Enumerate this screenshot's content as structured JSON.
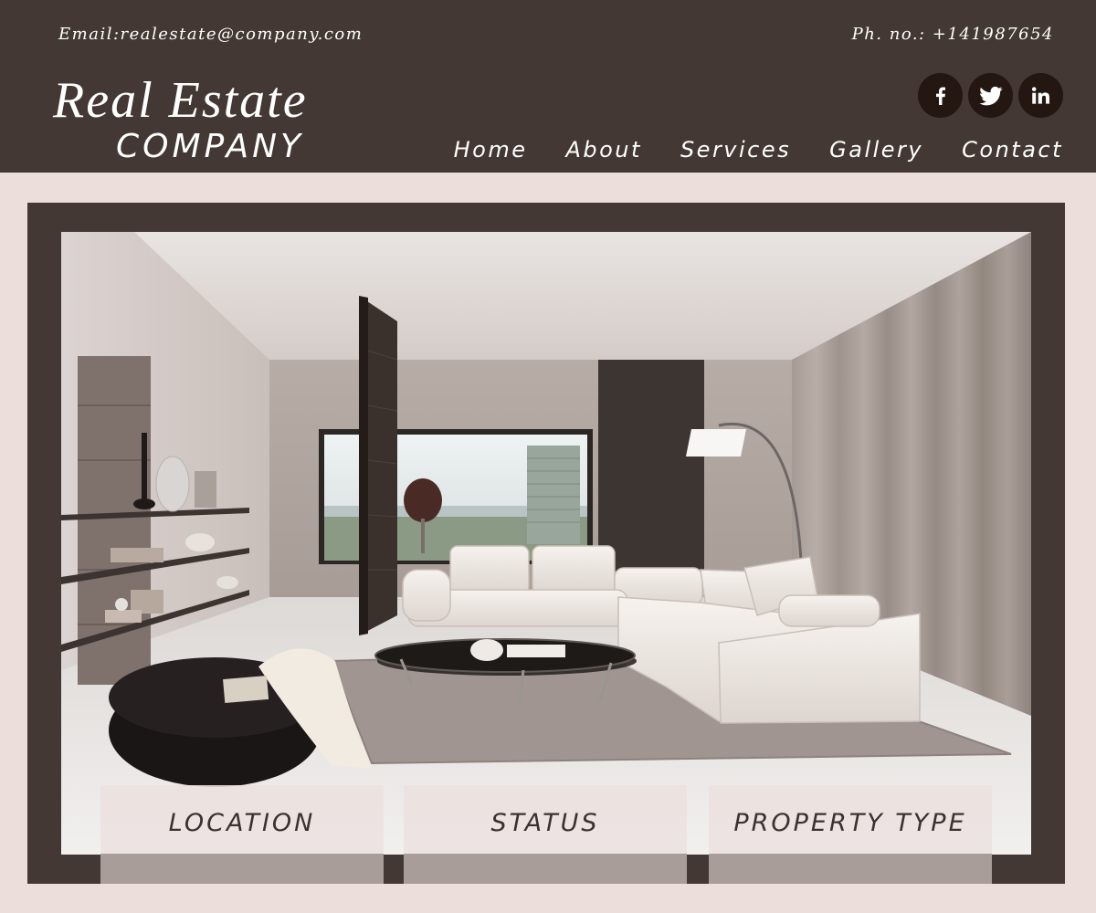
{
  "header": {
    "email": "Email:realestate@company.com",
    "phone": "Ph. no.: +141987654",
    "logo_main": "Real Estate",
    "logo_sub": "COMPANY",
    "socials": [
      {
        "name": "facebook",
        "icon": "facebook-icon",
        "glyph": "f"
      },
      {
        "name": "twitter",
        "icon": "twitter-icon",
        "glyph": "bird"
      },
      {
        "name": "linkedin",
        "icon": "linkedin-icon",
        "glyph": "in"
      }
    ],
    "nav": [
      "Home",
      "About",
      "Services",
      "Gallery",
      "Contact"
    ]
  },
  "hero": {
    "image": "living-room-interior-photo"
  },
  "filters": [
    "LOCATION",
    "STATUS",
    "PROPERTY TYPE"
  ],
  "colors": {
    "header_bg": "#433833",
    "page_bg": "#ecdedb",
    "social_bg": "#241712",
    "text_light": "#ffffff",
    "filter_text": "#3b3230"
  }
}
